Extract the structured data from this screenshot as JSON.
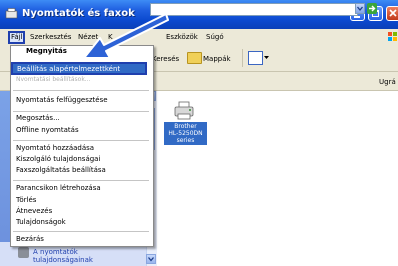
{
  "window": {
    "title": "Nyomtatók és faxok"
  },
  "menubar": {
    "file": "Fájl",
    "edit": "Szerkesztés",
    "view": "Nézet",
    "favorites": "K",
    "tools": "Eszközök",
    "help": "Súgó"
  },
  "toolbar": {
    "search": "Keresés",
    "folders": "Mappák"
  },
  "address": {
    "go_label": "Ugrá"
  },
  "file_menu": {
    "open": "Megnyitás",
    "set_default": "Beállítás alapértelmezettként",
    "printing_preferences_partial": "Nyomtatási beállítások...",
    "pause_printing": "Nyomtatás felfüggesztése",
    "sharing": "Megosztás...",
    "use_offline": "Offline nyomtatás",
    "add_printer": "Nyomtató hozzáadása",
    "server_properties": "Kiszolgáló tulajdonságai",
    "fax_setup": "Faxszolgáltatás beállítása",
    "create_shortcut": "Parancsikon létrehozása",
    "delete": "Törlés",
    "rename": "Átnevezés",
    "properties": "Tulajdonságok",
    "close": "Bezárás"
  },
  "taskpane": {
    "link_line1": "A nyomtatók",
    "link_line2": "tulajdonságainak"
  },
  "printer": {
    "line1": "Brother",
    "line2": "HL-5250DN",
    "line3": "series"
  },
  "colors": {
    "titlebar": "#0b49cf",
    "highlight": "#316ac5",
    "arrow": "#2d62d6"
  }
}
